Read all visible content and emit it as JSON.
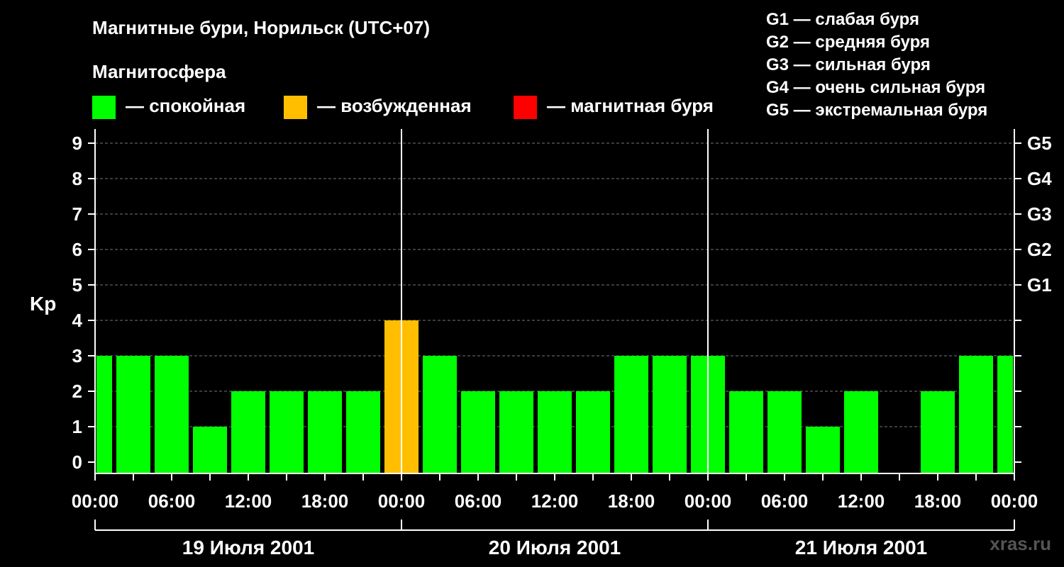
{
  "title": "Магнитные бури, Норильск (UTC+07)",
  "subtitle": "Магнитосфера",
  "legend": [
    {
      "label": "— спокойная",
      "color": "#00ff00"
    },
    {
      "label": "— возбужденная",
      "color": "#ffbf00"
    },
    {
      "label": "— магнитная буря",
      "color": "#ff0000"
    }
  ],
  "g_legend": [
    "G1 — слабая буря",
    "G2 — средняя буря",
    "G3 — сильная буря",
    "G4 — очень сильная буря",
    "G5 — экстремальная буря"
  ],
  "watermark": "xras.ru",
  "chart_data": {
    "type": "bar",
    "ylabel": "Kp",
    "ylim": [
      0,
      9
    ],
    "y_ticks": [
      0,
      1,
      2,
      3,
      4,
      5,
      6,
      7,
      8,
      9
    ],
    "right_ticks": [
      {
        "value": 5,
        "label": "G1"
      },
      {
        "value": 6,
        "label": "G2"
      },
      {
        "value": 7,
        "label": "G3"
      },
      {
        "value": 8,
        "label": "G4"
      },
      {
        "value": 9,
        "label": "G5"
      }
    ],
    "x_tick_labels": [
      "00:00",
      "06:00",
      "12:00",
      "18:00",
      "00:00",
      "06:00",
      "12:00",
      "18:00",
      "00:00",
      "06:00",
      "12:00",
      "18:00",
      "00:00"
    ],
    "days": [
      "19 Июля 2001",
      "20 Июля 2001",
      "21 Июля 2001"
    ],
    "interval_hours": 3,
    "values": [
      3,
      3,
      3,
      1,
      2,
      2,
      2,
      2,
      4,
      3,
      2,
      2,
      2,
      2,
      3,
      3,
      3,
      2,
      2,
      1,
      2,
      0,
      2,
      3,
      3
    ],
    "colors": {
      "quiet": "#00ff00",
      "active": "#ffbf00",
      "storm": "#ff0000"
    },
    "grid": true
  }
}
